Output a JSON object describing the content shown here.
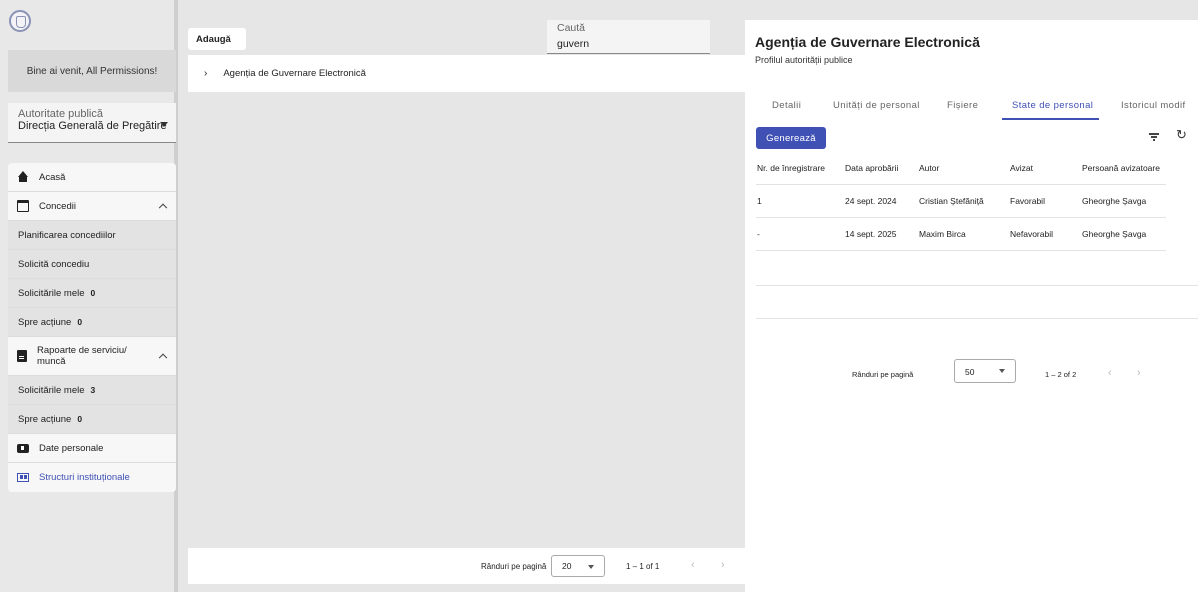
{
  "sidebar": {
    "welcome": "Bine ai venit, All Permissions!",
    "authority_label": "Autoritate publică",
    "authority_value": "Direcția Generală de Pregătire",
    "menu": {
      "home": "Acasă",
      "leave": "Concedii",
      "leave_planning": "Planificarea concediilor",
      "leave_request": "Solicită concediu",
      "my_requests": "Solicitările mele",
      "my_requests_count": "0",
      "to_action": "Spre acțiune",
      "to_action_count": "0",
      "reports": "Rapoarte de serviciu/ muncă",
      "reports_my_requests": "Solicitările mele",
      "reports_my_requests_count": "3",
      "reports_to_action": "Spre acțiune",
      "reports_to_action_count": "0",
      "personal_data": "Date personale",
      "structures": "Structuri instituționale"
    }
  },
  "middle": {
    "add_label": "Adaugă",
    "search_label": "Caută",
    "search_value": "guvern",
    "tree_item": "Agenția de Guvernare Electronică",
    "rows_per_page_label": "Rânduri pe pagină",
    "rows_per_page_value": "20",
    "range": "1 – 1 of 1"
  },
  "right": {
    "title": "Agenția de Guvernare Electronică",
    "subtitle": "Profilul autorității publice",
    "tabs": [
      "Detalii",
      "Unități de personal",
      "Fișiere",
      "State de personal",
      "Istoricul modif"
    ],
    "active_tab": "State de personal",
    "generate_label": "Generează",
    "table": {
      "headers": [
        "Nr. de înregistrare",
        "Data aprobării",
        "Autor",
        "Avizat",
        "Persoană avizatoare"
      ],
      "rows": [
        [
          "1",
          "24 sept. 2024",
          "Cristian Ștefăniță",
          "Favorabil",
          "Gheorghe Șavga"
        ],
        [
          "-",
          "14 sept. 2025",
          "Maxim Birca",
          "Nefavorabil",
          "Gheorghe Șavga"
        ]
      ]
    },
    "rows_per_page_label": "Rânduri pe pagină",
    "rows_per_page_value": "50",
    "range": "1 – 2 of 2"
  },
  "colors": {
    "accent": "#3f51b5"
  },
  "icons": [
    "home-icon",
    "calendar-icon",
    "document-icon",
    "id-card-icon",
    "org-structure-icon",
    "filter-icon",
    "refresh-icon",
    "chevron-up-icon",
    "chevron-right-icon",
    "dropdown-arrow-icon",
    "chevron-left-icon"
  ]
}
